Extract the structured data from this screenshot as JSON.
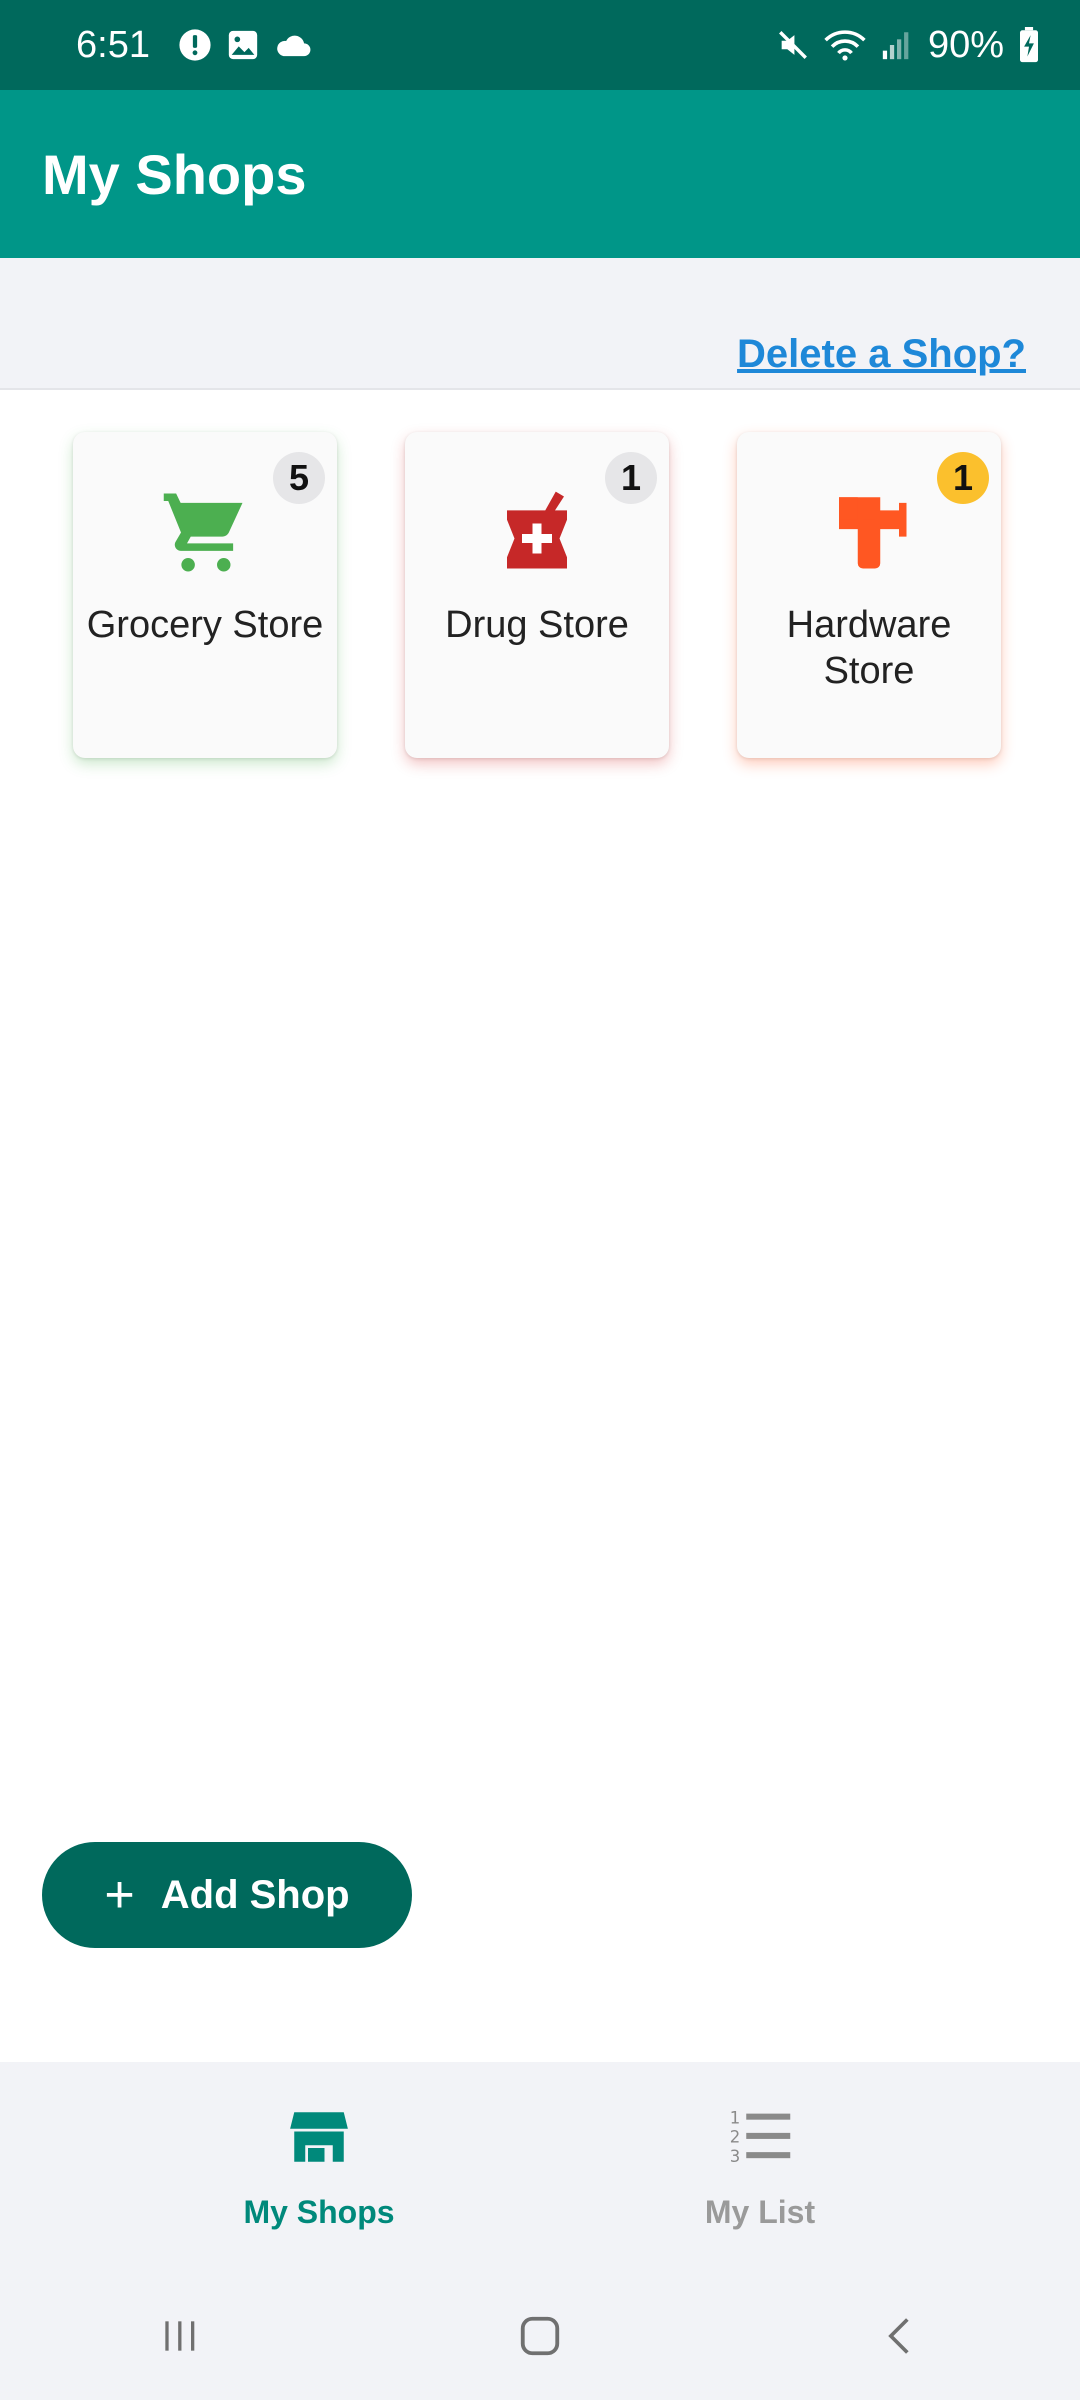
{
  "status_bar": {
    "time": "6:51",
    "battery": "90%",
    "icons": [
      "alert-circle-icon",
      "image-icon",
      "cloud-icon",
      "mute-icon",
      "wifi-icon",
      "signal-icon",
      "battery-charging-icon"
    ]
  },
  "app_bar": {
    "title": "My Shops"
  },
  "actions": {
    "delete_link": "Delete a Shop?"
  },
  "shops": [
    {
      "name": "Grocery Store",
      "count": "5",
      "icon": "shopping-cart-icon",
      "color": "#4caf50"
    },
    {
      "name": "Drug Store",
      "count": "1",
      "icon": "pharmacy-icon",
      "color": "#c62828"
    },
    {
      "name": "Hardware Store",
      "count": "1",
      "icon": "hammer-icon",
      "color": "#ff5722",
      "badge_color": "#fbc02d"
    }
  ],
  "fab": {
    "label": "Add Shop",
    "icon": "plus-icon"
  },
  "bottom_nav": [
    {
      "label": "My Shops",
      "icon": "store-icon",
      "active": true
    },
    {
      "label": "My List",
      "icon": "numbered-list-icon",
      "active": false
    }
  ],
  "colors": {
    "primary": "#009688",
    "primary_dark": "#00695c",
    "link": "#1e88d8"
  }
}
